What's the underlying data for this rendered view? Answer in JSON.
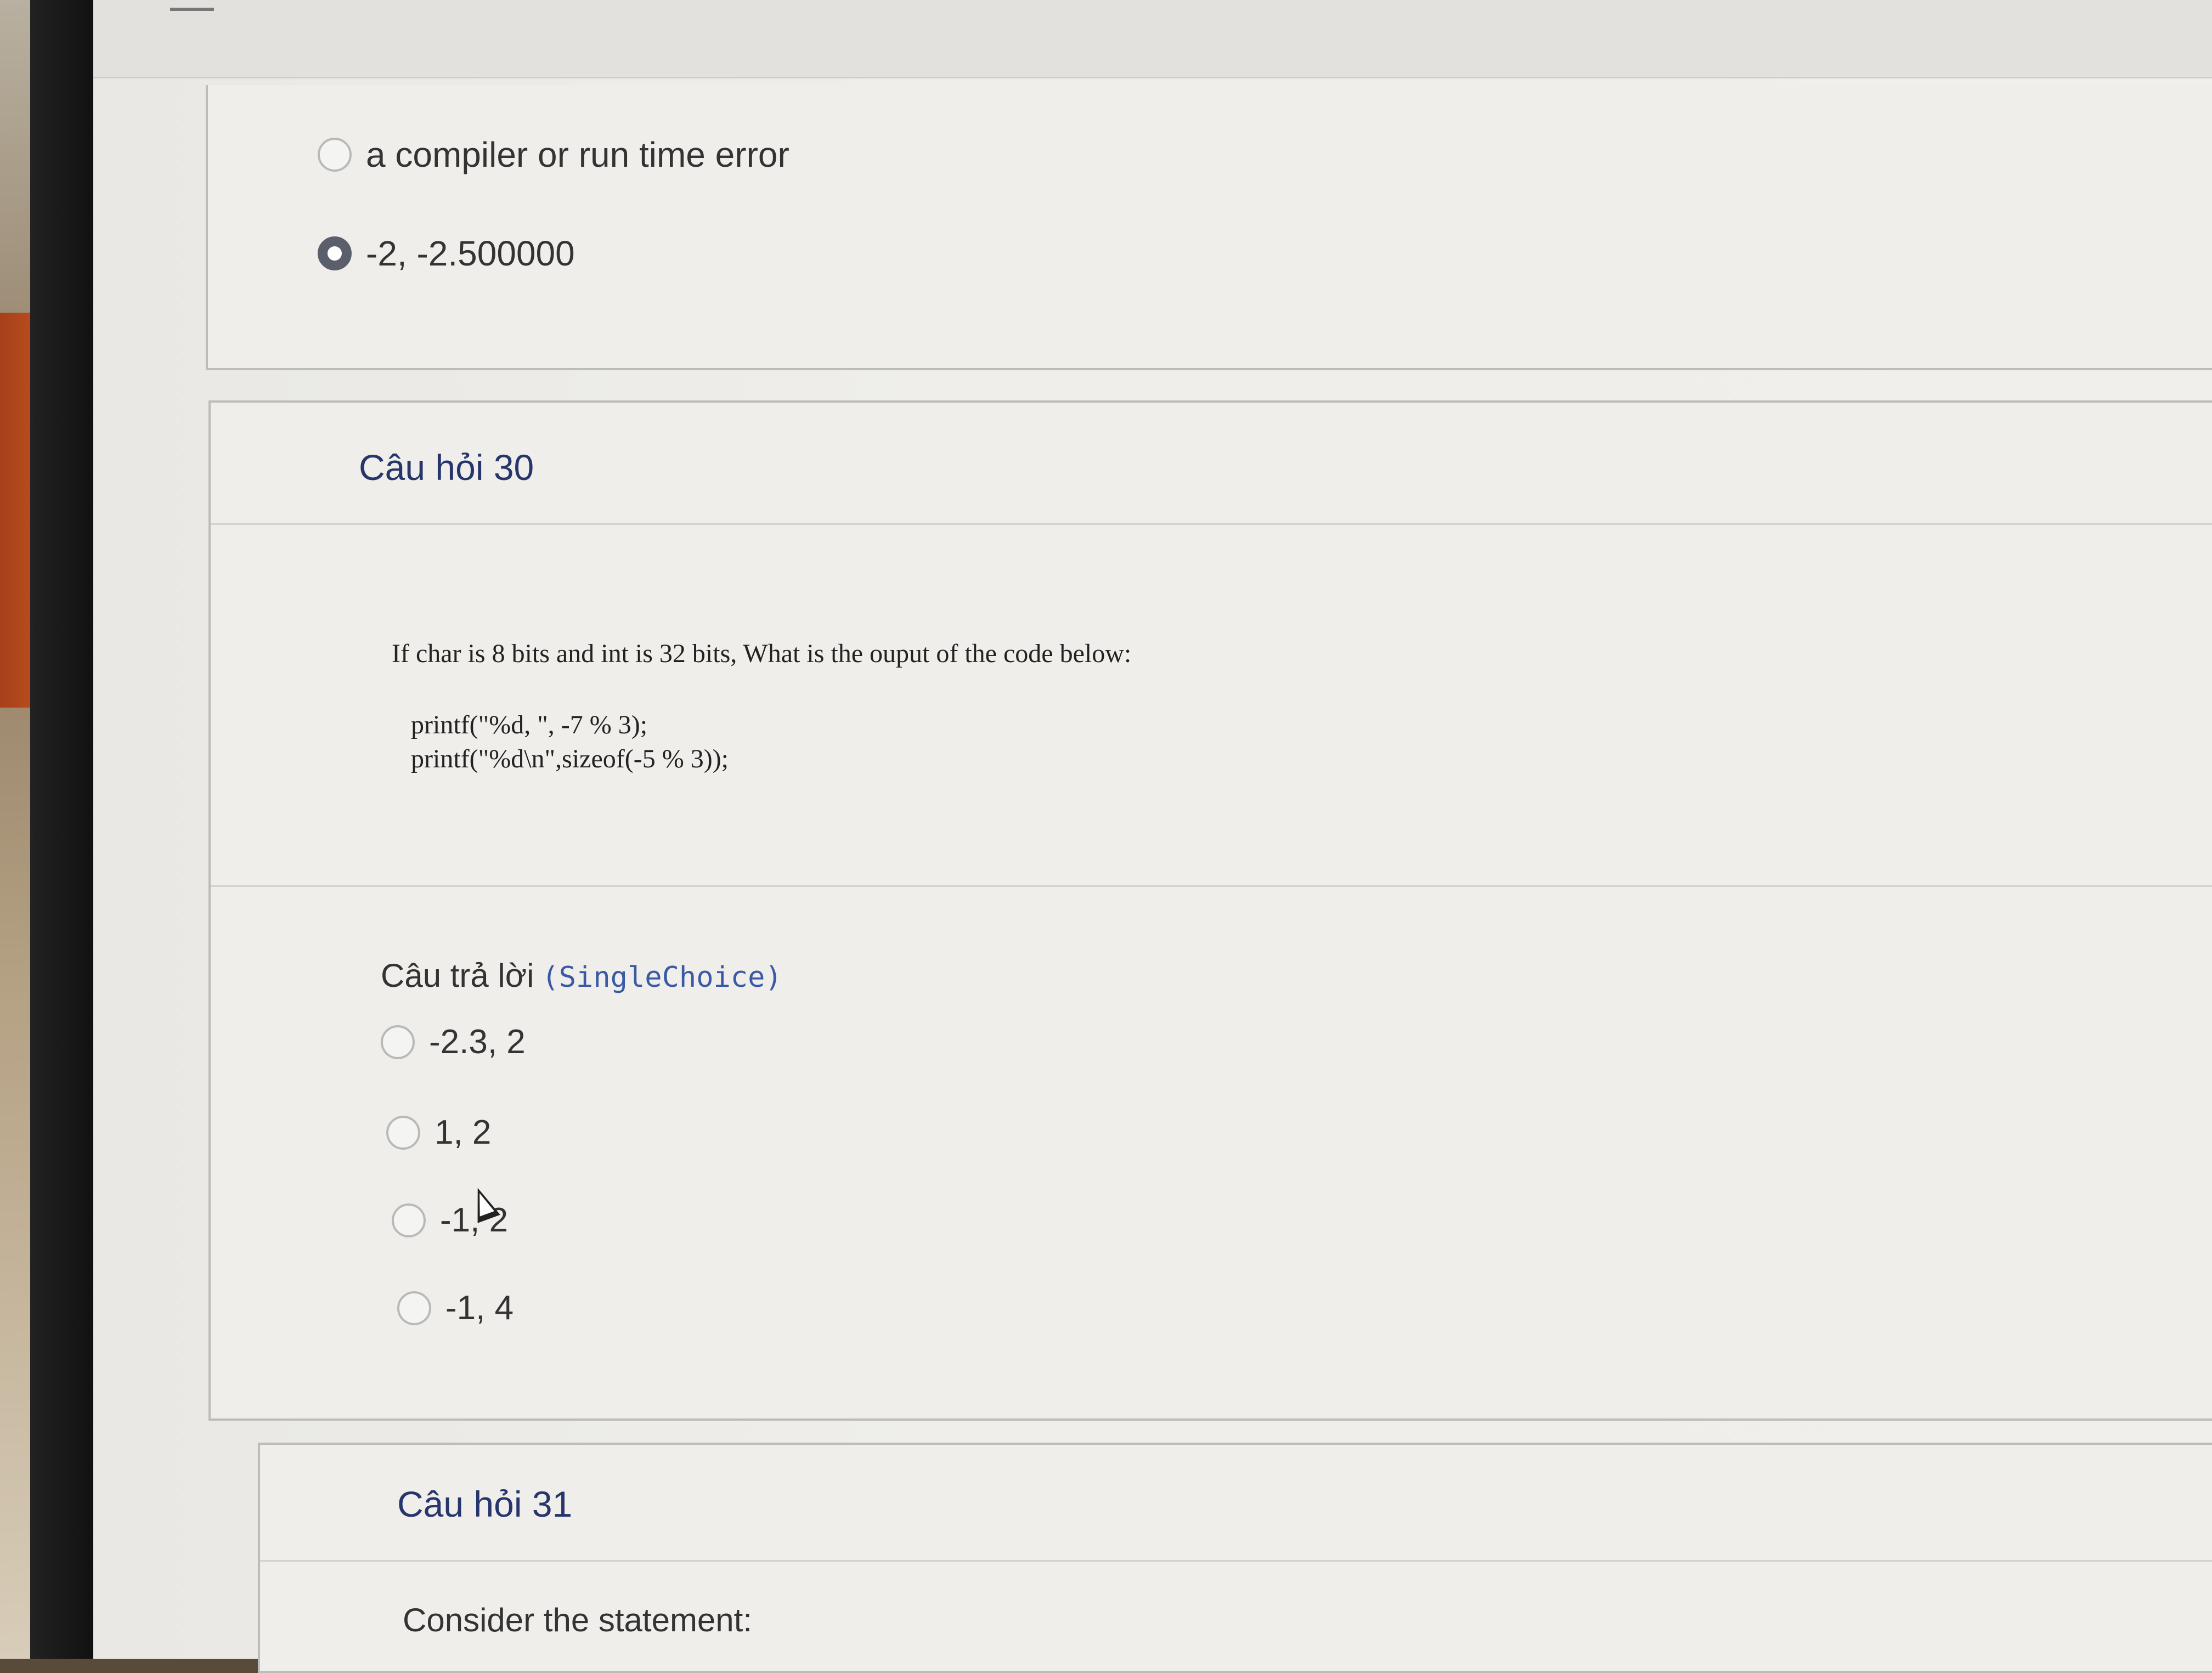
{
  "previous_question": {
    "options": [
      {
        "label": "a compiler or run time error",
        "selected": false
      },
      {
        "label": "-2, -2.500000",
        "selected": true
      }
    ]
  },
  "question_30": {
    "title": "Câu hỏi 30",
    "prompt": "If char is 8 bits and int is 32 bits, What is the ouput of the code below:",
    "code": [
      "printf(\"%d, \", -7 % 3);",
      "printf(\"%d\\n\",sizeof(-5 % 3));"
    ],
    "answer_label": "Câu trả lời",
    "answer_type": "(SingleChoice)",
    "options": [
      {
        "label": "-2.3, 2",
        "selected": false
      },
      {
        "label": "1, 2",
        "selected": false
      },
      {
        "label": "-1, 2",
        "selected": false
      },
      {
        "label": "-1, 4",
        "selected": false
      }
    ]
  },
  "question_31": {
    "title": "Câu hỏi 31",
    "prompt": "Consider the statement:"
  }
}
